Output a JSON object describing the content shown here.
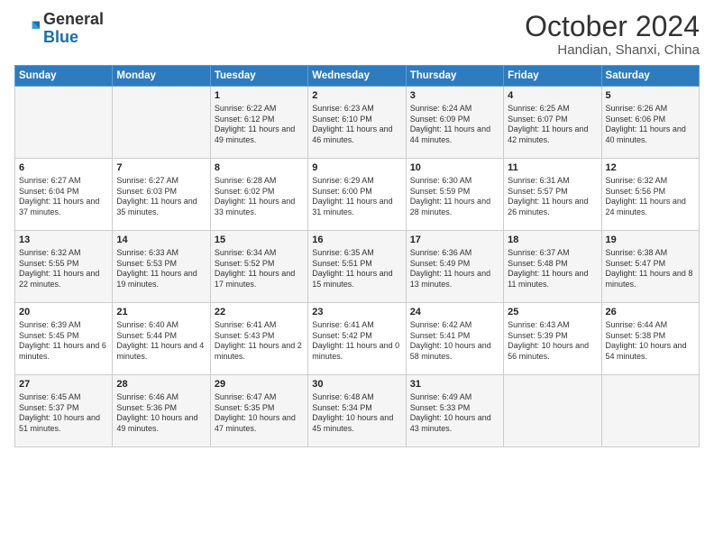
{
  "logo": {
    "general": "General",
    "blue": "Blue"
  },
  "header": {
    "month": "October 2024",
    "location": "Handian, Shanxi, China"
  },
  "weekdays": [
    "Sunday",
    "Monday",
    "Tuesday",
    "Wednesday",
    "Thursday",
    "Friday",
    "Saturday"
  ],
  "weeks": [
    [
      {
        "day": "",
        "detail": ""
      },
      {
        "day": "",
        "detail": ""
      },
      {
        "day": "1",
        "detail": "Sunrise: 6:22 AM\nSunset: 6:12 PM\nDaylight: 11 hours and 49 minutes."
      },
      {
        "day": "2",
        "detail": "Sunrise: 6:23 AM\nSunset: 6:10 PM\nDaylight: 11 hours and 46 minutes."
      },
      {
        "day": "3",
        "detail": "Sunrise: 6:24 AM\nSunset: 6:09 PM\nDaylight: 11 hours and 44 minutes."
      },
      {
        "day": "4",
        "detail": "Sunrise: 6:25 AM\nSunset: 6:07 PM\nDaylight: 11 hours and 42 minutes."
      },
      {
        "day": "5",
        "detail": "Sunrise: 6:26 AM\nSunset: 6:06 PM\nDaylight: 11 hours and 40 minutes."
      }
    ],
    [
      {
        "day": "6",
        "detail": "Sunrise: 6:27 AM\nSunset: 6:04 PM\nDaylight: 11 hours and 37 minutes."
      },
      {
        "day": "7",
        "detail": "Sunrise: 6:27 AM\nSunset: 6:03 PM\nDaylight: 11 hours and 35 minutes."
      },
      {
        "day": "8",
        "detail": "Sunrise: 6:28 AM\nSunset: 6:02 PM\nDaylight: 11 hours and 33 minutes."
      },
      {
        "day": "9",
        "detail": "Sunrise: 6:29 AM\nSunset: 6:00 PM\nDaylight: 11 hours and 31 minutes."
      },
      {
        "day": "10",
        "detail": "Sunrise: 6:30 AM\nSunset: 5:59 PM\nDaylight: 11 hours and 28 minutes."
      },
      {
        "day": "11",
        "detail": "Sunrise: 6:31 AM\nSunset: 5:57 PM\nDaylight: 11 hours and 26 minutes."
      },
      {
        "day": "12",
        "detail": "Sunrise: 6:32 AM\nSunset: 5:56 PM\nDaylight: 11 hours and 24 minutes."
      }
    ],
    [
      {
        "day": "13",
        "detail": "Sunrise: 6:32 AM\nSunset: 5:55 PM\nDaylight: 11 hours and 22 minutes."
      },
      {
        "day": "14",
        "detail": "Sunrise: 6:33 AM\nSunset: 5:53 PM\nDaylight: 11 hours and 19 minutes."
      },
      {
        "day": "15",
        "detail": "Sunrise: 6:34 AM\nSunset: 5:52 PM\nDaylight: 11 hours and 17 minutes."
      },
      {
        "day": "16",
        "detail": "Sunrise: 6:35 AM\nSunset: 5:51 PM\nDaylight: 11 hours and 15 minutes."
      },
      {
        "day": "17",
        "detail": "Sunrise: 6:36 AM\nSunset: 5:49 PM\nDaylight: 11 hours and 13 minutes."
      },
      {
        "day": "18",
        "detail": "Sunrise: 6:37 AM\nSunset: 5:48 PM\nDaylight: 11 hours and 11 minutes."
      },
      {
        "day": "19",
        "detail": "Sunrise: 6:38 AM\nSunset: 5:47 PM\nDaylight: 11 hours and 8 minutes."
      }
    ],
    [
      {
        "day": "20",
        "detail": "Sunrise: 6:39 AM\nSunset: 5:45 PM\nDaylight: 11 hours and 6 minutes."
      },
      {
        "day": "21",
        "detail": "Sunrise: 6:40 AM\nSunset: 5:44 PM\nDaylight: 11 hours and 4 minutes."
      },
      {
        "day": "22",
        "detail": "Sunrise: 6:41 AM\nSunset: 5:43 PM\nDaylight: 11 hours and 2 minutes."
      },
      {
        "day": "23",
        "detail": "Sunrise: 6:41 AM\nSunset: 5:42 PM\nDaylight: 11 hours and 0 minutes."
      },
      {
        "day": "24",
        "detail": "Sunrise: 6:42 AM\nSunset: 5:41 PM\nDaylight: 10 hours and 58 minutes."
      },
      {
        "day": "25",
        "detail": "Sunrise: 6:43 AM\nSunset: 5:39 PM\nDaylight: 10 hours and 56 minutes."
      },
      {
        "day": "26",
        "detail": "Sunrise: 6:44 AM\nSunset: 5:38 PM\nDaylight: 10 hours and 54 minutes."
      }
    ],
    [
      {
        "day": "27",
        "detail": "Sunrise: 6:45 AM\nSunset: 5:37 PM\nDaylight: 10 hours and 51 minutes."
      },
      {
        "day": "28",
        "detail": "Sunrise: 6:46 AM\nSunset: 5:36 PM\nDaylight: 10 hours and 49 minutes."
      },
      {
        "day": "29",
        "detail": "Sunrise: 6:47 AM\nSunset: 5:35 PM\nDaylight: 10 hours and 47 minutes."
      },
      {
        "day": "30",
        "detail": "Sunrise: 6:48 AM\nSunset: 5:34 PM\nDaylight: 10 hours and 45 minutes."
      },
      {
        "day": "31",
        "detail": "Sunrise: 6:49 AM\nSunset: 5:33 PM\nDaylight: 10 hours and 43 minutes."
      },
      {
        "day": "",
        "detail": ""
      },
      {
        "day": "",
        "detail": ""
      }
    ]
  ]
}
